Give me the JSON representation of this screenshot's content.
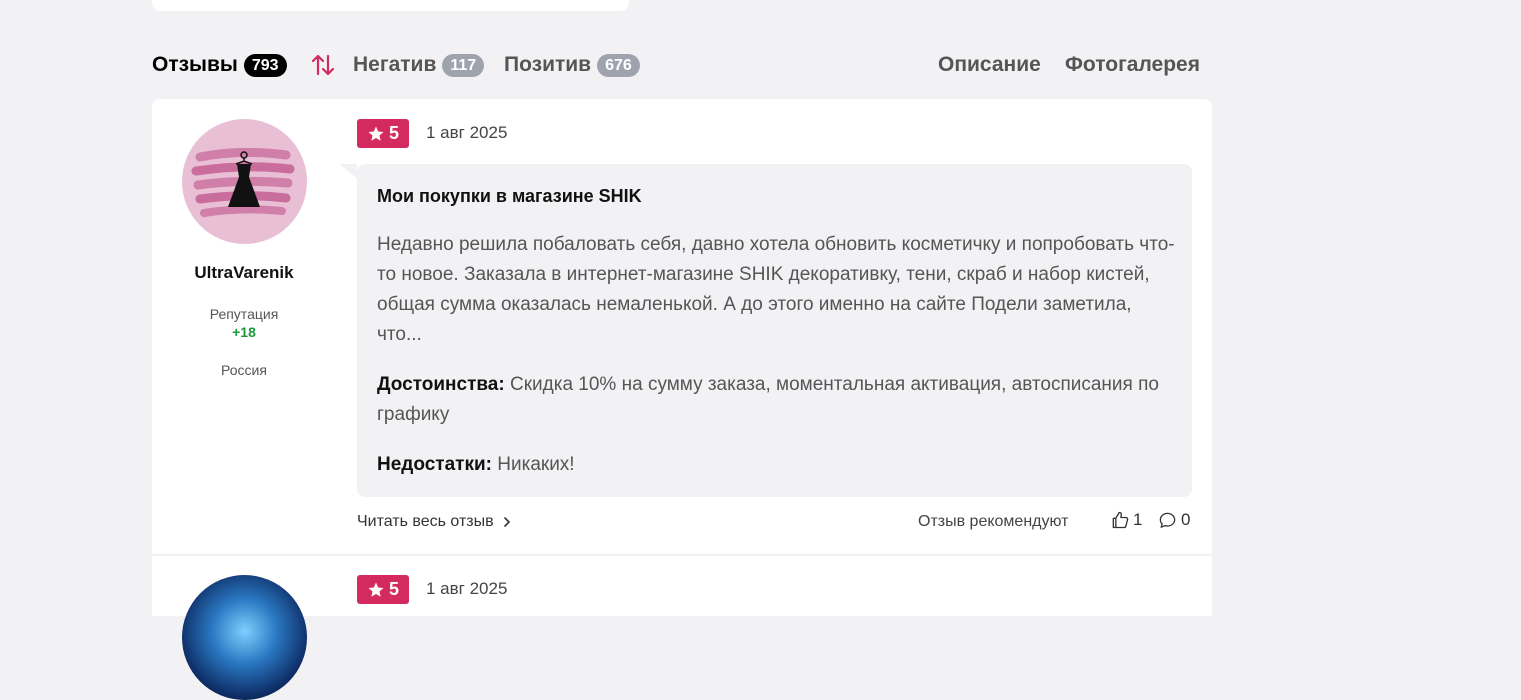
{
  "tabs": {
    "reviews": {
      "label": "Отзывы",
      "count": "793"
    },
    "negative": {
      "label": "Негатив",
      "count": "117"
    },
    "positive": {
      "label": "Позитив",
      "count": "676"
    },
    "description": {
      "label": "Описание"
    },
    "gallery": {
      "label": "Фотогалерея"
    }
  },
  "review": {
    "username": "UltraVarenik",
    "reputation_label": "Репутация",
    "reputation_value": "+18",
    "country": "Россия",
    "rating": "5",
    "date": "1 авг 2025",
    "title": "Мои покупки в магазине SHIK",
    "text": "Недавно решила побаловать себя, давно хотела обновить косметичку и попробовать что-то новое. Заказала в интернет-магазине SHIK декоративку, тени, скраб и набор кистей, общая сумма оказалась немаленькой. А до этого именно на сайте Подели заметила, что...",
    "pros_label": "Достоинства:",
    "pros": "Скидка 10% на сумму заказа, моментальная активация, автосписания по графику",
    "cons_label": "Недостатки:",
    "cons": "Никаких!",
    "read_more": "Читать весь отзыв",
    "recommend": "Отзыв рекомендуют",
    "likes": "1",
    "comments": "0"
  },
  "review2": {
    "rating": "5",
    "date": "1 авг 2025"
  },
  "colors": {
    "accent": "#d32a5f",
    "reputation": "#1a9a3a",
    "badge_active": "#000000",
    "badge_inactive": "#9ea3ad"
  }
}
